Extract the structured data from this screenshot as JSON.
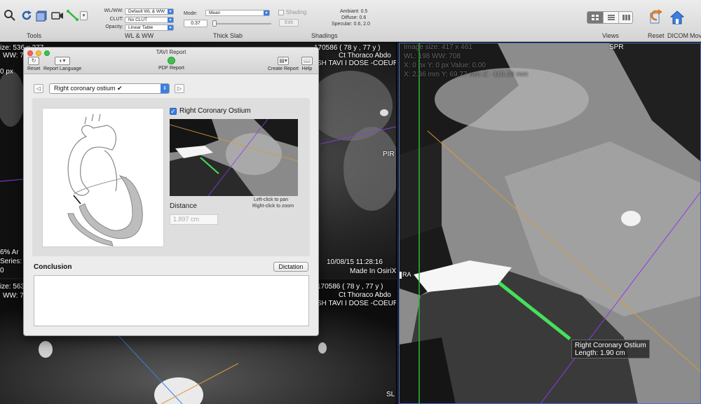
{
  "toolbar": {
    "groups": {
      "tools": "Tools",
      "wlww": "WL & WW",
      "thick_slab": "Thick Slab",
      "shadings": "Shadings",
      "views": "Views",
      "reset": "Reset",
      "dicom": "DICOM",
      "more": "Mov"
    },
    "wlww_label": "WL/WW:",
    "wlww_value": "Default WL & WW",
    "clut_label": "CLUT:",
    "clut_value": "No CLUT",
    "opacity_label": "Opacity:",
    "opacity_value": "Linear Table",
    "mode_label": "Mode:",
    "mode_value": "Mean",
    "slab_value": "0.37",
    "shading_label": "Shading",
    "edit_label": "Edit",
    "ambiant": "Ambiant: 0.5",
    "diffuse": "Diffuse: 0.6",
    "specular": "Specular: 0.6, 2.0"
  },
  "viewports": {
    "top_left": {
      "id_line": "170586 ( 78 y , 77 y )",
      "study": "Ct Thoraco Abdo",
      "series": "SH TAVI I DOSE -COEUR",
      "orient_right": "PIR",
      "left_fragments": [
        "ize: 536 x 277",
        "WW: 7",
        "0 px",
        "6% Ar",
        "Series:",
        "0"
      ],
      "date": "10/08/15 11:28:16",
      "made_in": "Made In OsiriX"
    },
    "bottom_left": {
      "id_line": "170586 ( 78 y , 77 y )",
      "study": "Ct Thoraco Abdo",
      "series": "SH TAVI I DOSE -COEUR",
      "left_fragments": [
        "ize: 563",
        "WW: 7"
      ],
      "orient_right": "SL"
    },
    "right": {
      "orient_top": "SPR",
      "orient_left": "RA",
      "info": [
        "Image size: 417 x 461",
        "WL: 198 WW: 708",
        "X: 0 px Y: 0 px Value: 0.00",
        "X: 2.36 mm Y: 69.77 mm Z: -113.28 mm"
      ],
      "measure_name": "Right Coronary Ostium",
      "measure_length": "Length: 1.90 cm"
    }
  },
  "dialog": {
    "title": "TAVI Report",
    "toolbar_items": {
      "reset": "Reset",
      "report_language": "Report Language",
      "pdf_report": "PDF Report",
      "create_report": "Create Report",
      "help": "Help"
    },
    "step_selector": "Right coronary ostium ✔",
    "checkbox_label": "Right Coronary Ostium",
    "checked": true,
    "hint_pan": "Left-click to pan",
    "hint_zoom": "Right-click to zoom",
    "distance_label": "Distance",
    "distance_value": "1.897 cm",
    "conclusion_label": "Conclusion",
    "dictation_button": "Dictation",
    "conclusion_text": ""
  },
  "colors": {
    "measure_green": "#46e05a",
    "line_orange": "#d89a3a",
    "line_purple": "#8a3de0",
    "line_green": "#2fb83a",
    "accent_blue": "#3b7fe0"
  }
}
